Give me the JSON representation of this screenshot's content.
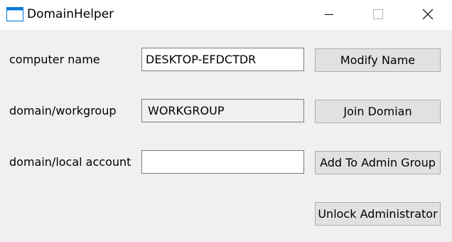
{
  "window": {
    "title": "DomainHelper",
    "controls": {
      "minimize_icon": "minimize-icon",
      "maximize_icon": "maximize-icon",
      "close_icon": "close-icon"
    }
  },
  "form": {
    "computer_name": {
      "label": "computer name",
      "value": "DESKTOP-EFDCTDR",
      "button": "Modify Name"
    },
    "domain_workgroup": {
      "label": "domain/workgroup",
      "value": "WORKGROUP",
      "button": "Join Domian"
    },
    "account": {
      "label": "domain/local account",
      "value": "",
      "button": "Add To Admin Group"
    },
    "unlock_button": "Unlock Administrator"
  },
  "colors": {
    "titlebar": "#ffffff",
    "client_area": "#f0f0f0",
    "button_face": "#e1e1e1",
    "button_border": "#adadad",
    "input_border": "#7a7a7a",
    "icon_accent": "#0078d7"
  }
}
